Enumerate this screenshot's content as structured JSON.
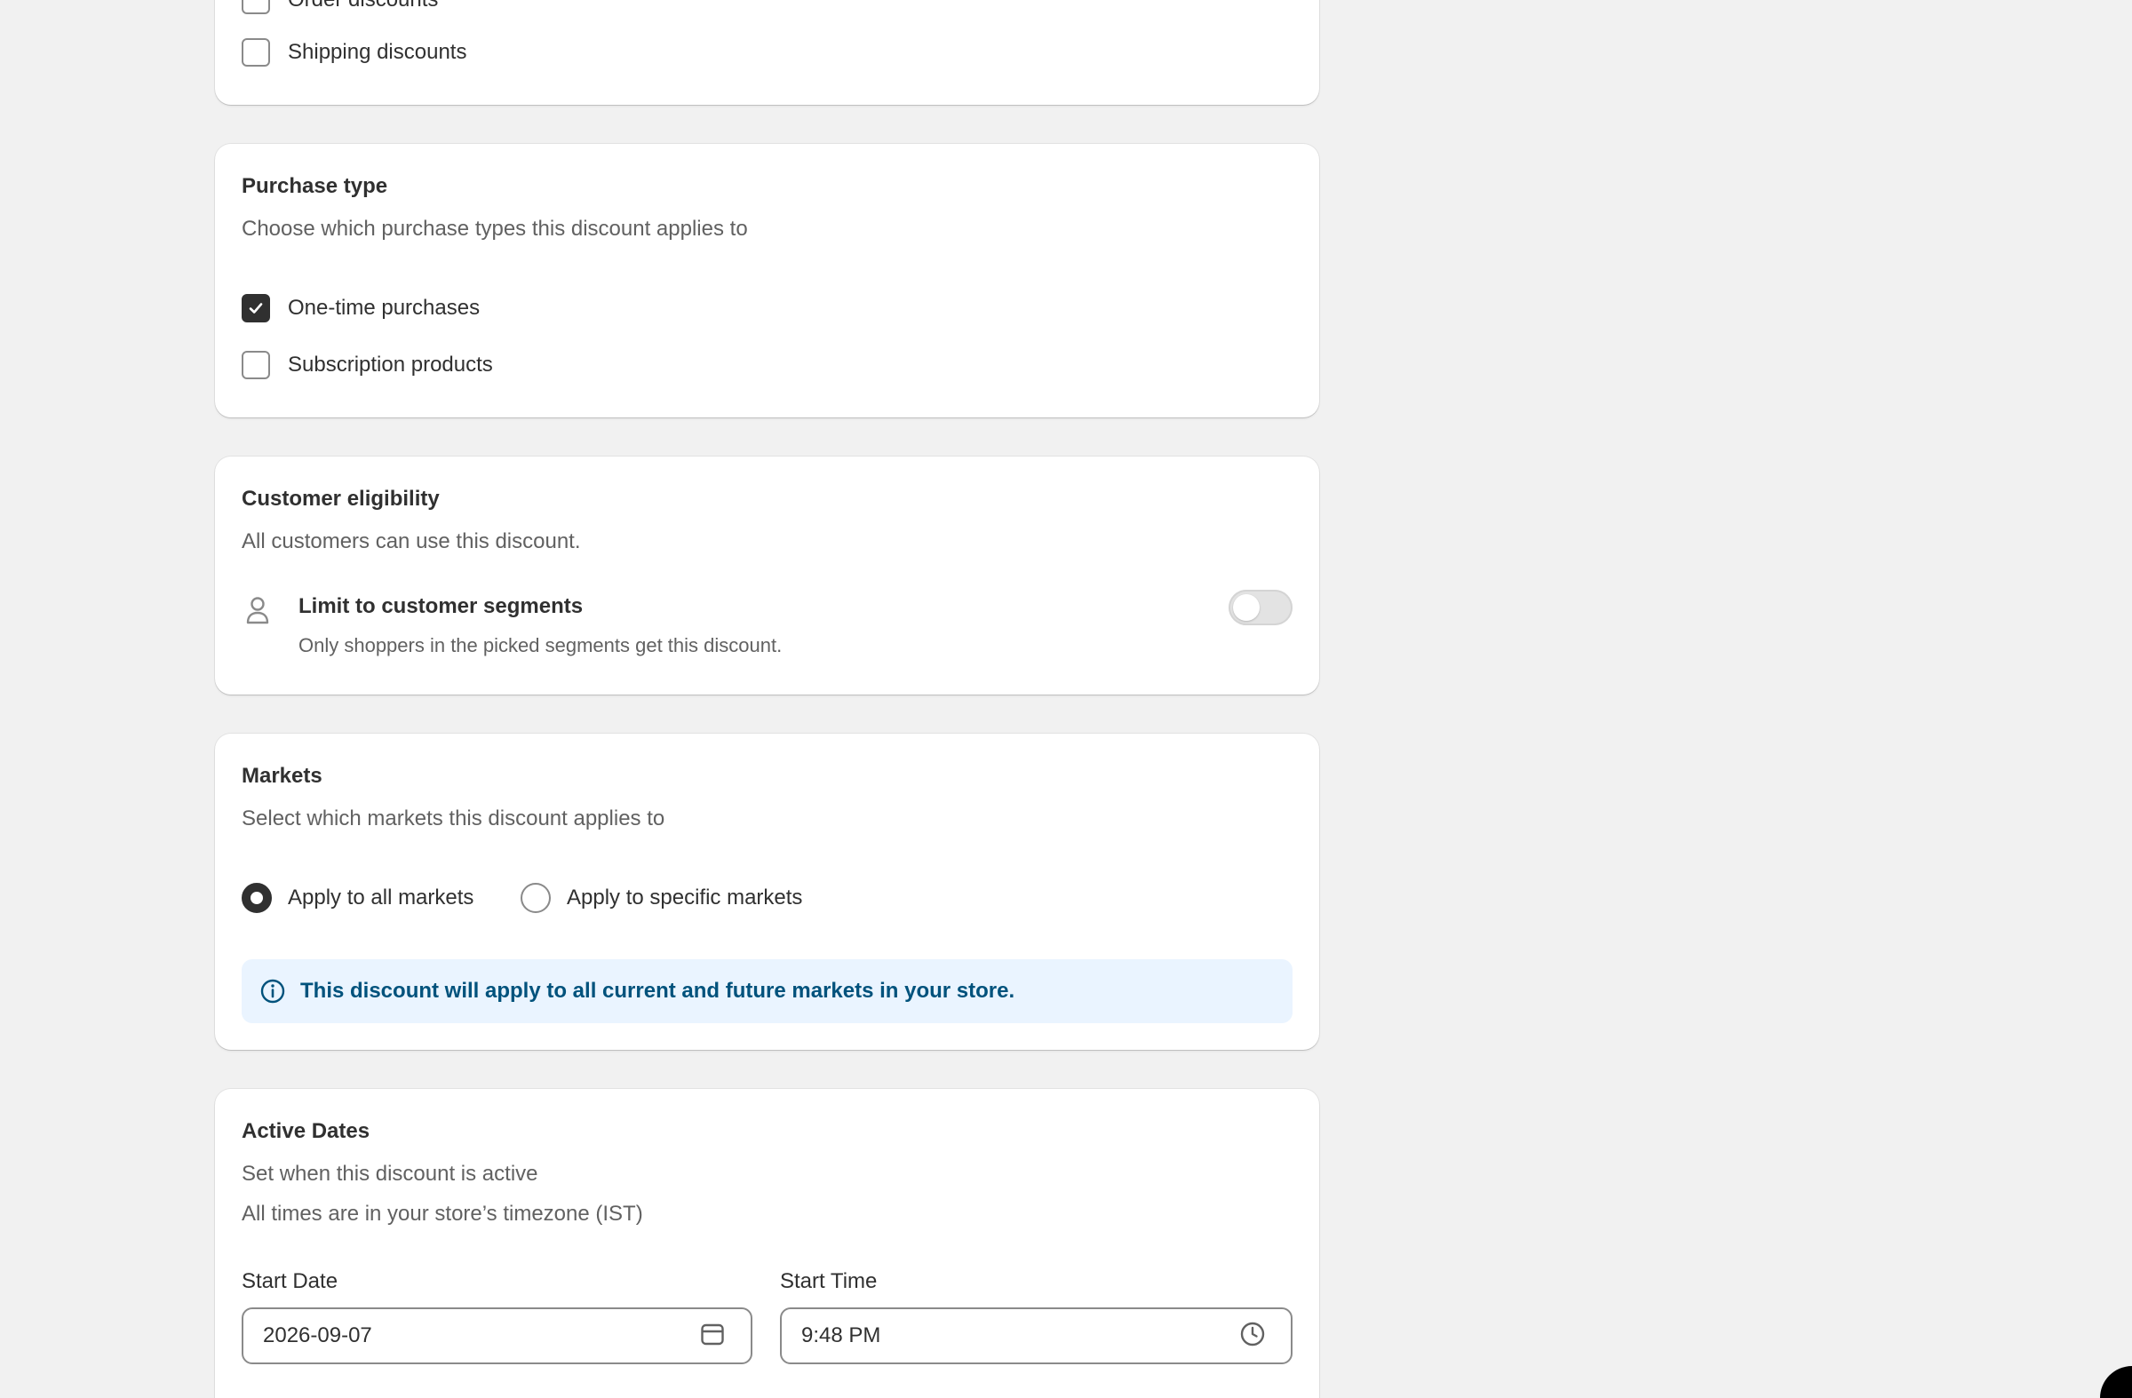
{
  "discount_classes": {
    "items": [
      {
        "label": "Order discounts",
        "checked": false
      },
      {
        "label": "Shipping discounts",
        "checked": false
      }
    ]
  },
  "purchase_type": {
    "title": "Purchase type",
    "subtitle": "Choose which purchase types this discount applies to",
    "options": [
      {
        "label": "One-time purchases",
        "checked": true
      },
      {
        "label": "Subscription products",
        "checked": false
      }
    ]
  },
  "customer_eligibility": {
    "title": "Customer eligibility",
    "subtitle": "All customers can use this discount.",
    "segment_toggle": {
      "label": "Limit to customer segments",
      "description": "Only shoppers in the picked segments get this discount.",
      "enabled": false,
      "icon": "person-icon"
    }
  },
  "markets": {
    "title": "Markets",
    "subtitle": "Select which markets this discount applies to",
    "options": [
      {
        "label": "Apply to all markets",
        "selected": true
      },
      {
        "label": "Apply to specific markets",
        "selected": false
      }
    ],
    "banner": {
      "text": "This discount will apply to all current and future markets in your store.",
      "icon": "info-icon"
    }
  },
  "active_dates": {
    "title": "Active Dates",
    "subtitle": "Set when this discount is active",
    "timezone_note": "All times are in your store’s timezone (IST)",
    "start_date": {
      "label": "Start Date",
      "value": "2026-09-07",
      "icon": "calendar-icon"
    },
    "start_time": {
      "label": "Start Time",
      "value": "9:48 PM",
      "icon": "clock-icon"
    }
  },
  "colors": {
    "page_bg": "#f1f1f1",
    "card_bg": "#ffffff",
    "banner_bg": "#eaf4ff",
    "banner_text": "#00527c",
    "checked_fill": "#303030"
  }
}
